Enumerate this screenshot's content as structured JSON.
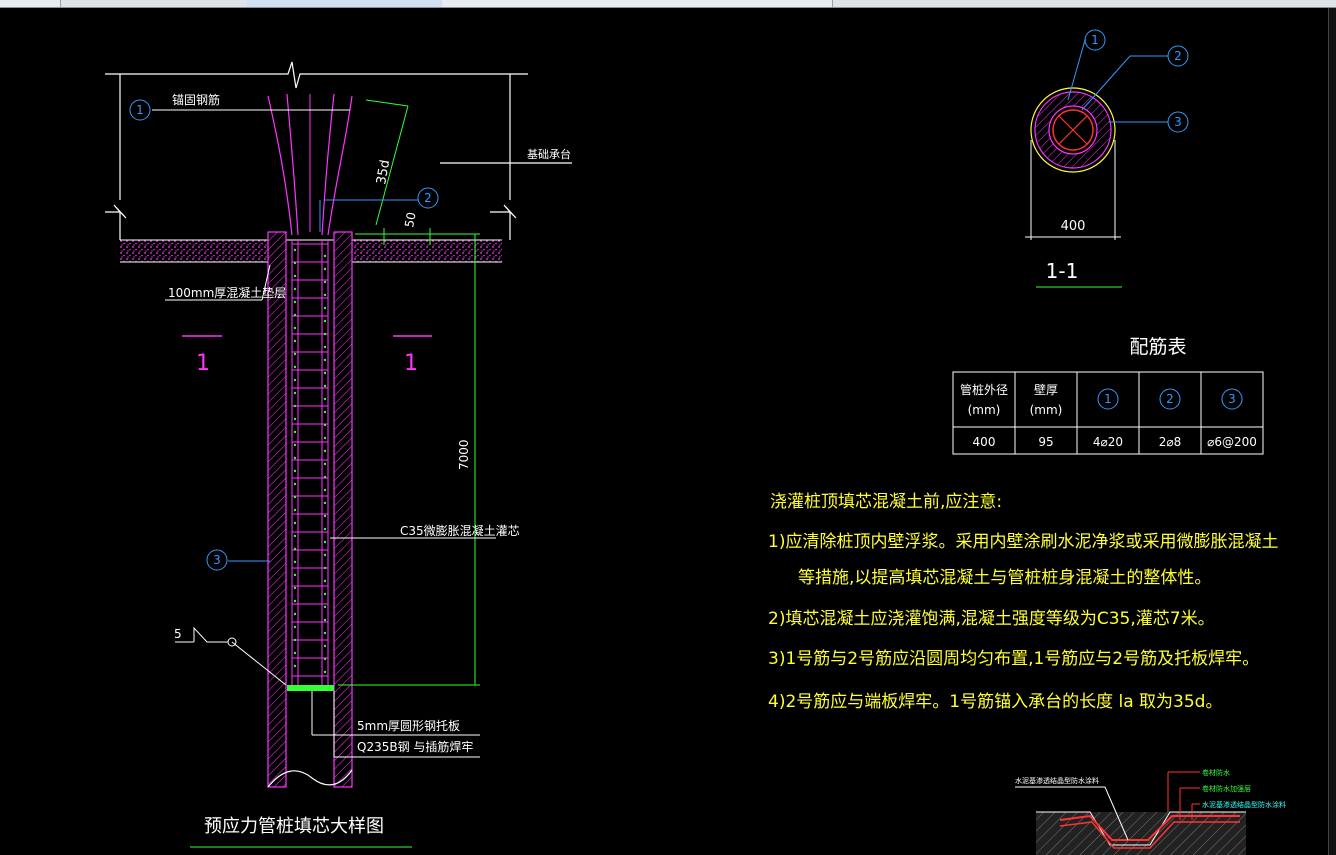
{
  "tabs": [
    "",
    "",
    "",
    "",
    "",
    ""
  ],
  "elevation": {
    "title": "预应力管桩填芯大样图",
    "callout1_text": "锚固钢筋",
    "callout_cap": "基础承台",
    "dim_35d": "35d",
    "dim_50": "50",
    "cushion_text": "100mm厚混凝土垫层",
    "section_mark_left": "1",
    "section_mark_right": "1",
    "dim_7000": "7000",
    "fill_text": "C35微膨胀混凝土灌芯",
    "weld_mark": "5",
    "plate_text_1": "5mm厚圆形钢托板",
    "plate_text_2": "Q235B钢 与插筋焊牢",
    "circle_1": "1",
    "circle_2": "2",
    "circle_3": "3"
  },
  "section": {
    "title": "1-1",
    "dim": "400",
    "c1": "1",
    "c2": "2",
    "c3": "3"
  },
  "table": {
    "title": "配筋表",
    "headers": [
      "管桩外径\n(mm)",
      "壁厚\n(mm)",
      "1",
      "2",
      "3"
    ],
    "h0a": "管桩外径",
    "h0b": "(mm)",
    "h1a": "壁厚",
    "h1b": "(mm)",
    "h2": "1",
    "h3": "2",
    "h4": "3",
    "r0": "400",
    "r1": "95",
    "r2": "4⌀20",
    "r3": "2⌀8",
    "r4": "⌀6@200"
  },
  "notes": {
    "heading": "浇灌桩顶填芯混凝土前,应注意:",
    "n1a": "1)应清除桩顶内壁浮浆。采用内壁涂刷水泥净浆或采用微膨胀混凝土",
    "n1b": "等措施,以提高填芯混凝土与管桩桩身混凝土的整体性。",
    "n2": "2)填芯混凝土应浇灌饱满,混凝土强度等级为C35,灌芯7米。",
    "n3": "3)1号筋与2号筋应沿圆周均匀布置,1号筋应与2号筋及托板焊牢。",
    "n4": "4)2号筋应与端板焊牢。1号筋锚入承台的长度 la 取为35d。"
  },
  "detail": {
    "l1": "水泥基渗透结晶型防水涂料",
    "r1": "卷材防水",
    "r2": "卷材防水加强层",
    "r3": "水泥基渗透结晶型防水涂料"
  },
  "colors": {
    "magenta": "#ff33ff",
    "white": "#ffffff",
    "green": "#33ff33",
    "blue": "#3399ff",
    "red": "#ff3333",
    "yellow": "#ffff33",
    "cyan": "#33ffff"
  }
}
